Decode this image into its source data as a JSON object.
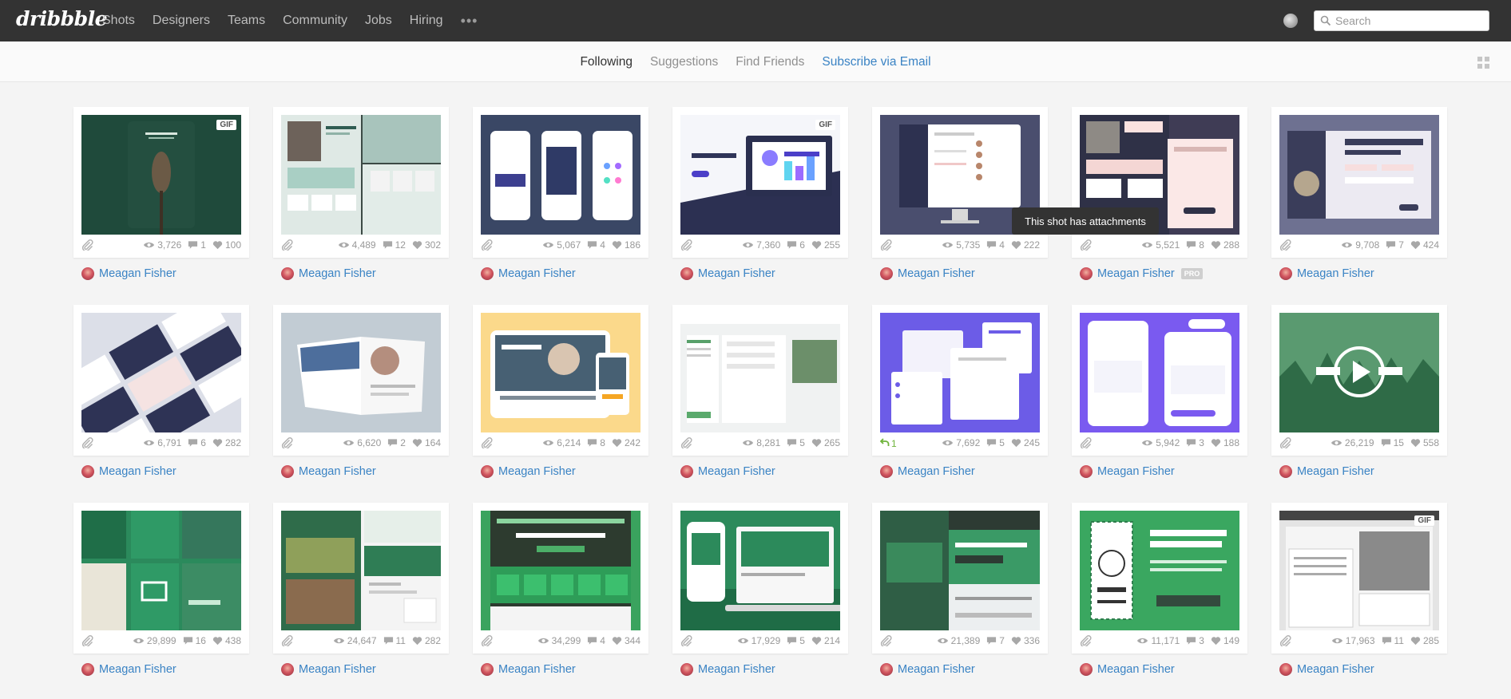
{
  "nav": {
    "logo": "dribbble",
    "links": [
      "Shots",
      "Designers",
      "Teams",
      "Community",
      "Jobs",
      "Hiring"
    ],
    "more": "•••",
    "search_placeholder": "Search"
  },
  "subnav": {
    "tabs": [
      {
        "label": "Following",
        "state": "active"
      },
      {
        "label": "Suggestions",
        "state": ""
      },
      {
        "label": "Find Friends",
        "state": ""
      },
      {
        "label": "Subscribe via Email",
        "state": "link"
      }
    ]
  },
  "tooltip": "This shot has attachments",
  "colors": {
    "link": "#3a83c4",
    "nav_bg": "#333333",
    "rebound": "#6fb33b"
  },
  "shots": [
    {
      "views": "3,726",
      "comments": "1",
      "likes": "100",
      "author": "Meagan Fisher",
      "gif": "GIF"
    },
    {
      "views": "4,489",
      "comments": "12",
      "likes": "302",
      "author": "Meagan Fisher"
    },
    {
      "views": "5,067",
      "comments": "4",
      "likes": "186",
      "author": "Meagan Fisher"
    },
    {
      "views": "7,360",
      "comments": "6",
      "likes": "255",
      "author": "Meagan Fisher",
      "gif": "GIF"
    },
    {
      "views": "5,735",
      "comments": "4",
      "likes": "222",
      "author": "Meagan Fisher"
    },
    {
      "views": "5,521",
      "comments": "8",
      "likes": "288",
      "author": "Meagan Fisher",
      "pro": "PRO"
    },
    {
      "views": "9,708",
      "comments": "7",
      "likes": "424",
      "author": "Meagan Fisher"
    },
    {
      "views": "6,791",
      "comments": "6",
      "likes": "282",
      "author": "Meagan Fisher"
    },
    {
      "views": "6,620",
      "comments": "2",
      "likes": "164",
      "author": "Meagan Fisher"
    },
    {
      "views": "6,214",
      "comments": "8",
      "likes": "242",
      "author": "Meagan Fisher"
    },
    {
      "views": "8,281",
      "comments": "5",
      "likes": "265",
      "author": "Meagan Fisher"
    },
    {
      "views": "7,692",
      "comments": "5",
      "likes": "245",
      "author": "Meagan Fisher",
      "rebounds": "1"
    },
    {
      "views": "5,942",
      "comments": "3",
      "likes": "188",
      "author": "Meagan Fisher"
    },
    {
      "views": "26,219",
      "comments": "15",
      "likes": "558",
      "author": "Meagan Fisher"
    },
    {
      "views": "29,899",
      "comments": "16",
      "likes": "438",
      "author": "Meagan Fisher"
    },
    {
      "views": "24,647",
      "comments": "11",
      "likes": "282",
      "author": "Meagan Fisher"
    },
    {
      "views": "34,299",
      "comments": "4",
      "likes": "344",
      "author": "Meagan Fisher"
    },
    {
      "views": "17,929",
      "comments": "5",
      "likes": "214",
      "author": "Meagan Fisher"
    },
    {
      "views": "21,389",
      "comments": "7",
      "likes": "336",
      "author": "Meagan Fisher"
    },
    {
      "views": "11,171",
      "comments": "3",
      "likes": "149",
      "author": "Meagan Fisher"
    },
    {
      "views": "17,963",
      "comments": "11",
      "likes": "285",
      "author": "Meagan Fisher",
      "gif": "GIF"
    }
  ]
}
